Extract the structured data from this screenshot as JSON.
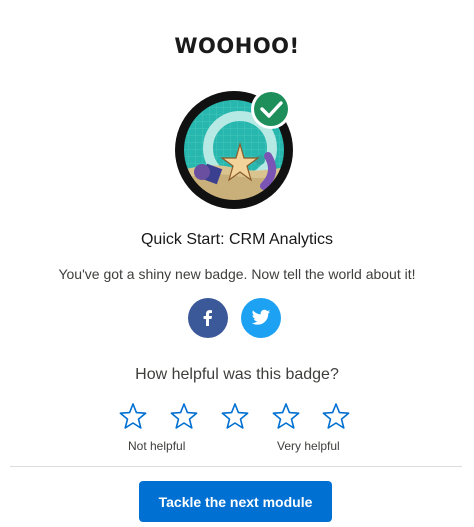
{
  "header": {
    "title": "WOOHOO!"
  },
  "badge": {
    "name": "CRM Analytics badge"
  },
  "module": {
    "title": "Quick Start: CRM Analytics"
  },
  "share": {
    "message": "You've got a shiny new badge. Now tell the world about it!",
    "facebook_color": "#3b5998",
    "twitter_color": "#1da1f2"
  },
  "feedback": {
    "question": "How helpful was this badge?",
    "rating": 0,
    "max_rating": 5,
    "low_label": "Not helpful",
    "high_label": "Very helpful",
    "star_color": "#0070d2"
  },
  "actions": {
    "next_label": "Tackle the next module",
    "accent": "#0070d2"
  }
}
